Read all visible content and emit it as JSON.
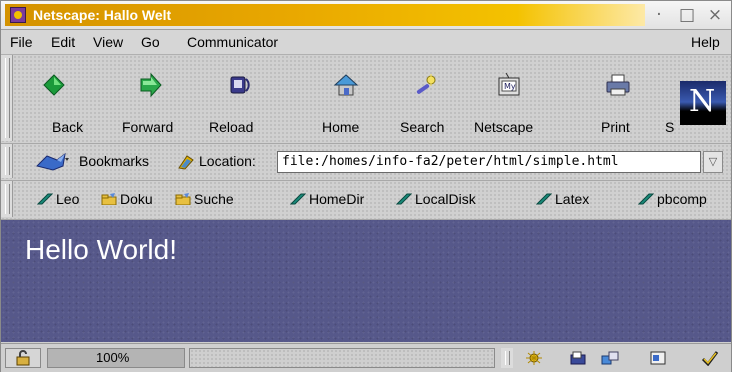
{
  "window": {
    "title": "Netscape: Hallo Welt",
    "controls": [
      "·",
      "□",
      "×"
    ]
  },
  "menu": [
    "File",
    "Edit",
    "View",
    "Go",
    "Communicator"
  ],
  "help_label": "Help",
  "nav": {
    "back": "Back",
    "forward": "Forward",
    "reload": "Reload",
    "home": "Home",
    "search": "Search",
    "netscape": "Netscape",
    "print": "Print",
    "security": "S"
  },
  "location": {
    "bookmarks_label": "Bookmarks",
    "location_label": "Location:",
    "url": "file:/homes/info-fa2/peter/html/simple.html"
  },
  "personal": [
    "Leo",
    "Doku",
    "Suche",
    "HomeDir",
    "LocalDisk",
    "Latex",
    "pbcomp"
  ],
  "content": {
    "heading": "Hello World!"
  },
  "status": {
    "zoom": "100%"
  },
  "colors": {
    "title_gradient_start": "#d49200",
    "page_background": "#56588a",
    "heading_text": "#ffffff"
  },
  "icons": {
    "nav": [
      "back-arrow-icon",
      "forward-arrow-icon",
      "reload-icon",
      "home-icon",
      "search-icon",
      "netscape-icon",
      "print-icon"
    ],
    "personal": [
      "bookmark-icon",
      "folder-icon",
      "folder-icon",
      "bookmark-icon",
      "bookmark-icon",
      "bookmark-icon",
      "bookmark-icon"
    ]
  }
}
